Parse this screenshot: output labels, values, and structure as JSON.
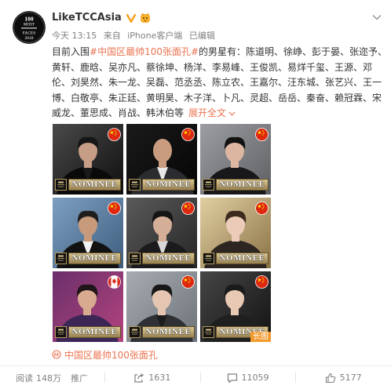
{
  "account": {
    "name": "LikeTCCAsia",
    "avatar_logo": [
      "100",
      "MOST",
      "FACES",
      "2018"
    ]
  },
  "meta": {
    "time": "今天 13:15",
    "source_prefix": "来自",
    "source": "iPhone客户端",
    "edited": "已编辑"
  },
  "post": {
    "line1": {
      "prefix": "目前入围",
      "hashtag": "#中国区最帅100张面孔#",
      "suffix": "的男星有：陈道明、徐峥、彭于晏、张迩予、"
    },
    "lines": [
      "黄轩、鹿晗、吴亦凡、蔡徐坤、杨洋、李易峰、王俊凯、易烊千玺、王源、邓",
      "伦、刘昊然、朱一龙、吴磊、范丞丞、陈立农、王嘉尔、汪东城、张艺兴、王一",
      "博、白敬亭、朱正廷、黄明昊、木子洋、卜凡、灵超、岳岳、秦奋、赖冠霖、宋"
    ],
    "last_line": "威龙、董思成、肖战、韩沐伯等",
    "expand_label": "展开全文"
  },
  "photos": [
    {
      "flag": "china",
      "badge": "NOMINEE",
      "bg1": "#4a4a4a",
      "bg2": "#0f0f0f",
      "suit": "#0a0a0a",
      "shirt": "#1a1a1a",
      "skin": "#c69d86",
      "hair": "#161616"
    },
    {
      "flag": "china",
      "badge": "NOMINEE",
      "bg1": "#1a1a1a",
      "bg2": "#050505",
      "suit": "#2b2c30",
      "shirt": "#e8e8e8",
      "skin": "#c99c80",
      "hair": null
    },
    {
      "flag": "china",
      "badge": "NOMINEE",
      "bg1": "#9c9ea2",
      "bg2": "#5c5e62",
      "suit": "#18181a",
      "shirt": "#18181a",
      "skin": "#dcb6a0",
      "hair": "#121212"
    },
    {
      "flag": "china",
      "badge": "NOMINEE",
      "bg1": "#7d9fc0",
      "bg2": "#3e5d7e",
      "suit": "#121212",
      "shirt": "#f2f2f2",
      "skin": "#c89a7c",
      "hair": "#1e1e1e"
    },
    {
      "flag": "china",
      "badge": "NOMINEE",
      "bg1": "#5a5a5a",
      "bg2": "#262626",
      "suit": "#1b1b1d",
      "shirt": "#d8d8d8",
      "skin": "#d4ae96",
      "hair": "#151515"
    },
    {
      "flag": "china",
      "badge": "NOMINEE",
      "bg1": "#e0cfa2",
      "bg2": "#8a7246",
      "suit": "#2c2521",
      "shirt": "#2c2521",
      "skin": "#ecccb8",
      "hair": "#3d2b1f"
    },
    {
      "flag": "canada",
      "badge": "NOMINEE",
      "bg1": "#6a2f6a",
      "bg2": "#b4447e",
      "suit": "#3b2656",
      "shirt": "#3b2656",
      "skin": "#d8aa8f",
      "hair": "#1f1418"
    },
    {
      "flag": "china",
      "badge": "NOMINEE",
      "bg1": "#a6acb2",
      "bg2": "#6c7278",
      "suit": "#2e3034",
      "shirt": "#1c1c1c",
      "skin": "#e4c6b2",
      "hair": "#181818"
    },
    {
      "flag": "china",
      "badge": "NOMINEE",
      "bg1": "#464646",
      "bg2": "#121212",
      "suit": "#1f1f1f",
      "shirt": "#1f1f1f",
      "skin": "#e8c9b4",
      "hair": "#1b1b1b",
      "long_image_label": "长图"
    }
  ],
  "topic_link": "中国区最帅100张面孔",
  "stats": {
    "reads_label": "阅读",
    "reads": "148万",
    "promote_label": "推广",
    "shares": "1631",
    "comments": "11059",
    "likes": "5177"
  },
  "colors": {
    "link": "#eb7350",
    "text": "#333333",
    "meta": "#808080",
    "verified": "#f6a623"
  }
}
